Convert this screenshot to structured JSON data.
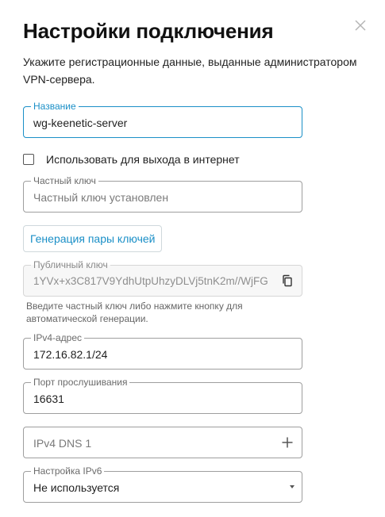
{
  "dialog": {
    "title": "Настройки подключения",
    "subtitle": "Укажите регистрационные данные, выданные администратором VPN-сервера."
  },
  "name_field": {
    "label": "Название",
    "value": "wg-keenetic-server"
  },
  "internet_checkbox": {
    "label": "Использовать для выхода в интернет",
    "checked": false
  },
  "private_key_field": {
    "label": "Частный ключ",
    "placeholder": "Частный ключ установлен"
  },
  "generate_button": {
    "label": "Генерация пары ключей"
  },
  "public_key_field": {
    "label": "Публичный ключ",
    "value": "1YVx+x3C817V9YdhUtpUhzyDLVj5tnK2m//WjFG",
    "icon": "copy-icon"
  },
  "public_key_hint": "Введите частный ключ либо нажмите кнопку для автоматической генерации.",
  "ipv4_field": {
    "label": "IPv4-адрес",
    "value": "172.16.82.1/24"
  },
  "port_field": {
    "label": "Порт прослушивания",
    "value": "16631"
  },
  "dns_field": {
    "placeholder": "IPv4 DNS 1",
    "icon": "plus-icon"
  },
  "ipv6_field": {
    "label": "Настройка IPv6",
    "value": "Не используется",
    "icon": "caret-down-icon"
  },
  "colors": {
    "accent": "#1a8fc7",
    "border": "#9e9e9e",
    "text": "#1f1f1f"
  }
}
